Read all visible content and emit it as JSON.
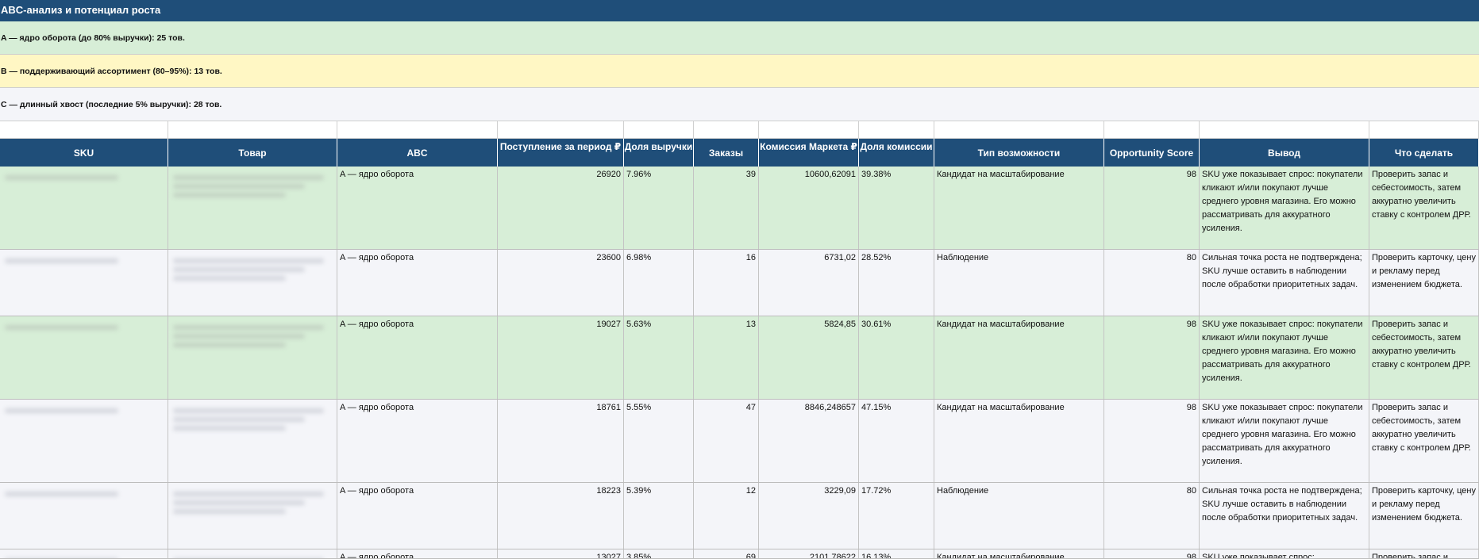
{
  "sheet": {
    "title": "ABC-анализ и потенциал роста",
    "summary": [
      "A — ядро оборота (до 80% выручки): 25 тов.",
      "B — поддерживающий ассортимент (80–95%): 13 тов.",
      "C — длинный хвост (последние 5% выручки): 28 тов."
    ],
    "colors": {
      "header_bg": "#1f4e79",
      "row_a_bg": "#d7eed7",
      "row_b_bg": "#fff7c4",
      "row_c_bg": "#f4f5f9"
    }
  },
  "table": {
    "headers": [
      "SKU",
      "Товар",
      "ABC",
      "Поступление за период ₽",
      "Доля выручки",
      "Заказы",
      "Комиссия Маркета ₽",
      "Доля комиссии",
      "Тип возможности",
      "Opportunity Score",
      "Вывод",
      "Что сделать"
    ],
    "rows": [
      {
        "abc": "A — ядро оборота",
        "revenue": "26920",
        "share": "7.96%",
        "orders": "39",
        "commission": "10600,62091",
        "commission_share": "39.38%",
        "type": "Кандидат на масштабирование",
        "score": "98",
        "conclusion": "SKU уже показывает спрос: покупатели кликают и/или покупают лучше среднего уровня магазина. Его можно рассматривать для аккуратного усиления.",
        "action": "Проверить запас и себестоимость, затем аккуратно увеличить ставку с контролем ДРР."
      },
      {
        "abc": "A — ядро оборота",
        "revenue": "23600",
        "share": "6.98%",
        "orders": "16",
        "commission": "6731,02",
        "commission_share": "28.52%",
        "type": "Наблюдение",
        "score": "80",
        "conclusion": "Сильная точка роста не подтверждена; SKU лучше оставить в наблюдении после обработки приоритетных задач.",
        "action": "Проверить карточку, цену и рекламу перед изменением бюджета."
      },
      {
        "abc": "A — ядро оборота",
        "revenue": "19027",
        "share": "5.63%",
        "orders": "13",
        "commission": "5824,85",
        "commission_share": "30.61%",
        "type": "Кандидат на масштабирование",
        "score": "98",
        "conclusion": "SKU уже показывает спрос: покупатели кликают и/или покупают лучше среднего уровня магазина. Его можно рассматривать для аккуратного усиления.",
        "action": "Проверить запас и себестоимость, затем аккуратно увеличить ставку с контролем ДРР."
      },
      {
        "abc": "A — ядро оборота",
        "revenue": "18761",
        "share": "5.55%",
        "orders": "47",
        "commission": "8846,248657",
        "commission_share": "47.15%",
        "type": "Кандидат на масштабирование",
        "score": "98",
        "conclusion": "SKU уже показывает спрос: покупатели кликают и/или покупают лучше среднего уровня магазина. Его можно рассматривать для аккуратного усиления.",
        "action": "Проверить запас и себестоимость, затем аккуратно увеличить ставку с контролем ДРР."
      },
      {
        "abc": "A — ядро оборота",
        "revenue": "18223",
        "share": "5.39%",
        "orders": "12",
        "commission": "3229,09",
        "commission_share": "17.72%",
        "type": "Наблюдение",
        "score": "80",
        "conclusion": "Сильная точка роста не подтверждена; SKU лучше оставить в наблюдении после обработки приоритетных задач.",
        "action": "Проверить карточку, цену и рекламу перед изменением бюджета."
      },
      {
        "abc": "A — ядро оборота",
        "revenue": "13027",
        "share": "3.85%",
        "orders": "69",
        "commission": "2101,78622",
        "commission_share": "16.13%",
        "type": "Кандидат на масштабирование",
        "score": "98",
        "conclusion": "SKU уже показывает спрос:",
        "action": "Проверить запас и себестоимость,"
      }
    ]
  }
}
